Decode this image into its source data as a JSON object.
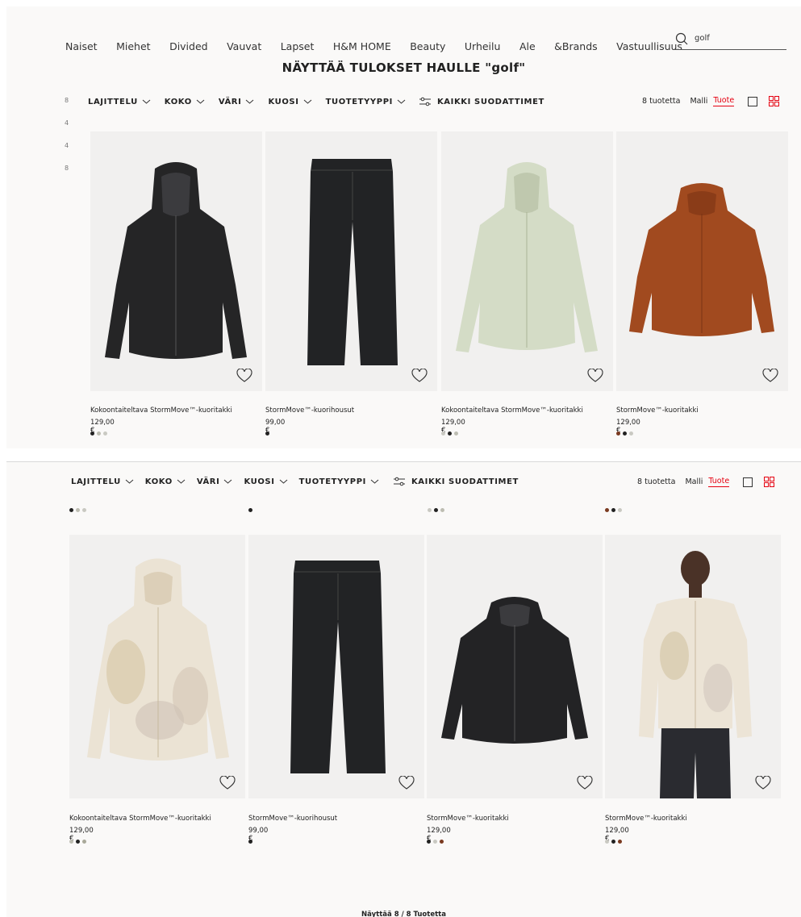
{
  "nav": {
    "items": [
      "Naiset",
      "Miehet",
      "Divided",
      "Vauvat",
      "Lapset",
      "H&M HOME",
      "Beauty",
      "Urheilu",
      "Ale",
      "&Brands",
      "Vastuullisuus"
    ]
  },
  "search": {
    "value": "golf"
  },
  "page_title": "NÄYTTÄÄ TULOKSET HAULLE \"golf\"",
  "filters": {
    "sort": "LAJITTELU",
    "size": "KOKO",
    "color": "VÄRI",
    "pattern": "KUOSI",
    "product_type": "TUOTETYYPPI",
    "all_filters": "KAIKKI SUODATTIMET"
  },
  "results": {
    "count_label": "8 tuotetta",
    "view_model": "Malli",
    "view_product": "Tuote"
  },
  "left_numbers": [
    "8",
    "4",
    "4",
    "8"
  ],
  "products": [
    {
      "name": "Kokoontaiteltava StormMove™-kuoritakki",
      "price": "129,00 €",
      "image": "black-hooded-jacket",
      "swatches": [
        "#222222",
        "#bdbdb2",
        "#c9c9c2"
      ]
    },
    {
      "name": "StormMove™-kuorihousut",
      "price": "99,00 €",
      "image": "black-pants",
      "swatches": [
        "#222222"
      ]
    },
    {
      "name": "Kokoontaiteltava StormMove™-kuoritakki",
      "price": "129,00 €",
      "image": "sage-hooded-jacket",
      "swatches": [
        "#c9c9c2",
        "#222222",
        "#bdbdb2"
      ]
    },
    {
      "name": "StormMove™-kuoritakki",
      "price": "129,00 €",
      "image": "rust-hooded-jacket",
      "swatches": [
        "#7a3a20",
        "#222222",
        "#c9c9c2"
      ]
    },
    {
      "name": "Kokoontaiteltava StormMove™-kuoritakki",
      "price": "129,00 €",
      "image": "tie-dye-hooded-jacket",
      "swatches": [
        "#bdbdb2",
        "#222222",
        "#a9a99a"
      ]
    },
    {
      "name": "StormMove™-kuorihousut",
      "price": "99,00 €",
      "image": "black-pants",
      "swatches": [
        "#222222"
      ]
    },
    {
      "name": "StormMove™-kuoritakki",
      "price": "129,00 €",
      "image": "black-hooded-jacket",
      "swatches": [
        "#222222",
        "#c9c9c2",
        "#7a3a20"
      ]
    },
    {
      "name": "StormMove™-kuoritakki",
      "price": "129,00 €",
      "image": "model-tie-dye-jacket",
      "swatches": [
        "#c9c9c2",
        "#222222",
        "#7a3a20"
      ]
    }
  ],
  "footer": {
    "label": "Näyttää 8 / 8 Tuotetta"
  },
  "colors": {
    "accent": "#e50010",
    "background": "#faf9f8",
    "image_bg": "#f1f0ef"
  }
}
